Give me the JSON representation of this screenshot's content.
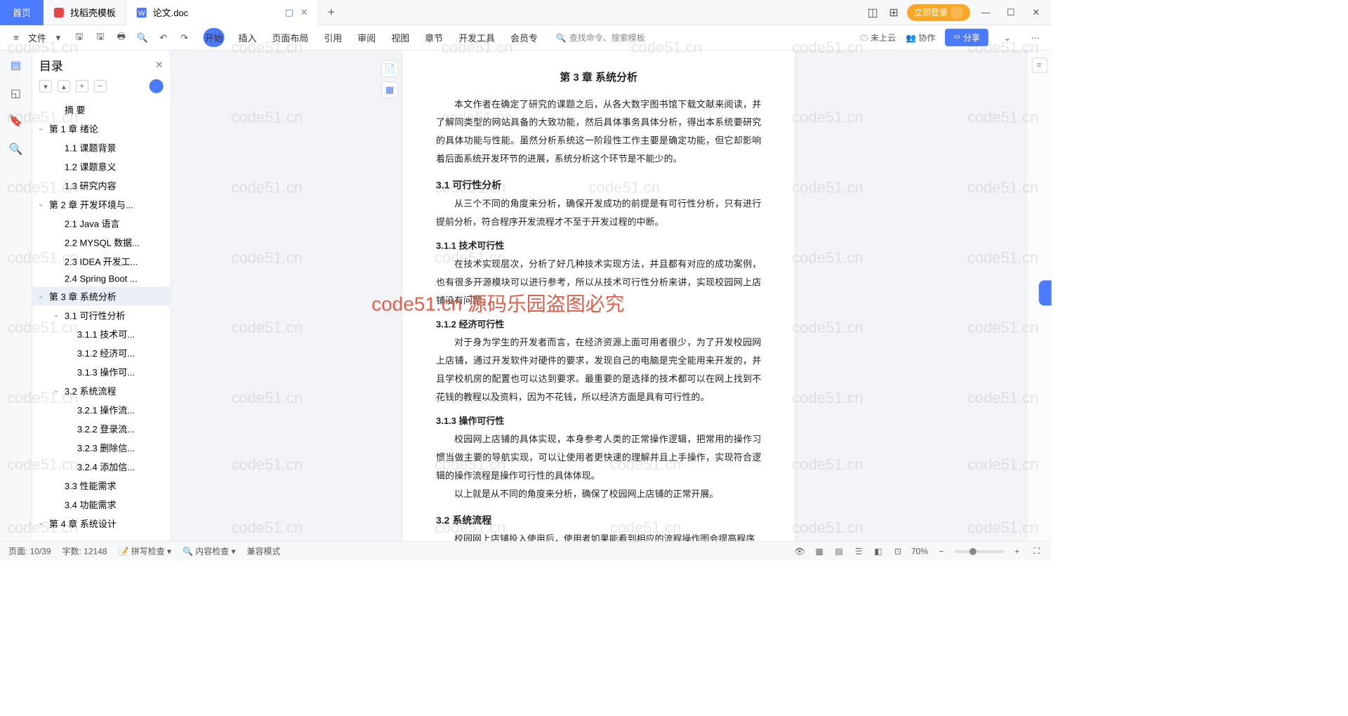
{
  "tabs": {
    "home": "首页",
    "template": "找稻壳模板",
    "doc": "论文.doc"
  },
  "login_btn": "立即登录",
  "toolbar": {
    "file": "文件",
    "menu": [
      "开始",
      "插入",
      "页面布局",
      "引用",
      "审阅",
      "视图",
      "章节",
      "开发工具",
      "会员专"
    ],
    "search": "查找命令、搜索模板",
    "cloud": "未上云",
    "collab": "协作",
    "share": "分享"
  },
  "outline": {
    "title": "目录",
    "items": [
      {
        "t": "摘  要",
        "l": 1
      },
      {
        "t": "第 1 章  绪论",
        "l": 0,
        "c": 1
      },
      {
        "t": "1.1  课题背景",
        "l": 1
      },
      {
        "t": "1.2  课题意义",
        "l": 1
      },
      {
        "t": "1.3  研究内容",
        "l": 1
      },
      {
        "t": "第 2 章  开发环境与...",
        "l": 0,
        "c": 1
      },
      {
        "t": "2.1 Java 语言",
        "l": 1
      },
      {
        "t": "2.2 MYSQL 数据...",
        "l": 1
      },
      {
        "t": "2.3 IDEA 开发工...",
        "l": 1
      },
      {
        "t": "2.4 Spring Boot ...",
        "l": 1
      },
      {
        "t": "第 3 章  系统分析",
        "l": 0,
        "c": 1,
        "sel": 1
      },
      {
        "t": "3.1  可行性分析",
        "l": 1,
        "c": 1
      },
      {
        "t": "3.1.1  技术可...",
        "l": 2
      },
      {
        "t": "3.1.2  经济可...",
        "l": 2
      },
      {
        "t": "3.1.3  操作可...",
        "l": 2
      },
      {
        "t": "3.2  系统流程",
        "l": 1,
        "c": 1
      },
      {
        "t": "3.2.1  操作流...",
        "l": 2
      },
      {
        "t": "3.2.2  登录流...",
        "l": 2
      },
      {
        "t": "3.2.3  删除信...",
        "l": 2
      },
      {
        "t": "3.2.4  添加信...",
        "l": 2
      },
      {
        "t": "3.3  性能需求",
        "l": 1
      },
      {
        "t": "3.4  功能需求",
        "l": 1
      },
      {
        "t": "第 4 章  系统设计",
        "l": 0,
        "c": 1
      }
    ]
  },
  "doc": {
    "chapter": "第 3 章  系统分析",
    "intro": "本文作者在确定了研究的课题之后，从各大数字图书馆下载文献来阅读，并了解同类型的网站具备的大致功能，然后具体事务具体分析，得出本系统要研究的具体功能与性能。虽然分析系统这一阶段性工作主要是确定功能，但它却影响着后面系统开发环节的进展，系统分析这个环节是不能少的。",
    "s31": "3.1  可行性分析",
    "p31": "从三个不同的角度来分析，确保开发成功的前提是有可行性分析，只有进行提前分析，符合程序开发流程才不至于开发过程的中断。",
    "s311": "3.1.1  技术可行性",
    "p311": "在技术实现层次，分析了好几种技术实现方法，并且都有对应的成功案例，也有很多开源模块可以进行参考，所以从技术可行性分析来讲，实现校园网上店铺没有问题。",
    "s312": "3.1.2  经济可行性",
    "p312": "对于身为学生的开发者而言，在经济资源上面可用者很少，为了开发校园网上店铺，通过开发软件对硬件的要求，发现自己的电脑是完全能用来开发的，并且学校机房的配置也可以达到要求。最重要的是选择的技术都可以在网上找到不花钱的教程以及资料，因为不花钱，所以经济方面是具有可行性的。",
    "s313": "3.1.3  操作可行性",
    "p313": "校园网上店铺的具体实现，本身参考人类的正常操作逻辑，把常用的操作习惯当做主要的导航实现，可以让使用者更快速的理解并且上手操作，实现符合逻辑的操作流程是操作可行性的具体体现。",
    "p313b": "以上就是从不同的角度来分析，确保了校园网上店铺的正常开展。",
    "s32": "3.2  系统流程",
    "p32": "校园网上店铺投入使用后，使用者如果能看到相应的流程操作图会提高程序"
  },
  "status": {
    "page": "页面: 10/39",
    "words": "字数: 12148",
    "spell": "拼写检查",
    "content": "内容检查",
    "compat": "兼容模式",
    "zoom": "70%"
  },
  "watermark_main": "code51.cn 源码乐园盗图必究",
  "wm": "code51.cn"
}
